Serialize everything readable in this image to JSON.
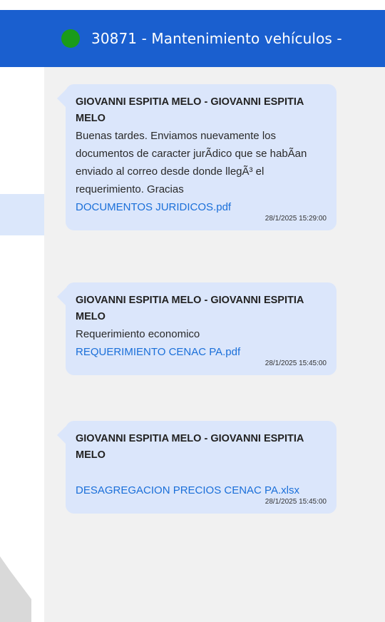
{
  "header": {
    "title": "30871 - Mantenimiento vehículos -",
    "status_color": "#1a9b1a",
    "accent": "#1a5fcf"
  },
  "messages": [
    {
      "sender": "GIOVANNI ESPITIA MELO - GIOVANNI ESPITIA MELO",
      "text": "Buenas tardes. Enviamos nuevamente los documentos de caracter jurÃdico que se habÃan enviado al correo desde donde llegÃ³ el requerimiento. Gracias",
      "attachment": "DOCUMENTOS JURIDICOS.pdf",
      "timestamp": "28/1/2025 15:29:00"
    },
    {
      "sender": "GIOVANNI ESPITIA MELO - GIOVANNI ESPITIA MELO",
      "text": "Requerimiento economico",
      "attachment": "REQUERIMIENTO CENAC PA.pdf",
      "timestamp": "28/1/2025 15:45:00"
    },
    {
      "sender": "GIOVANNI ESPITIA MELO - GIOVANNI ESPITIA MELO",
      "text": "",
      "attachment": "DESAGREGACION PRECIOS CENAC PA.xlsx",
      "timestamp": "28/1/2025 15:45:00"
    }
  ]
}
